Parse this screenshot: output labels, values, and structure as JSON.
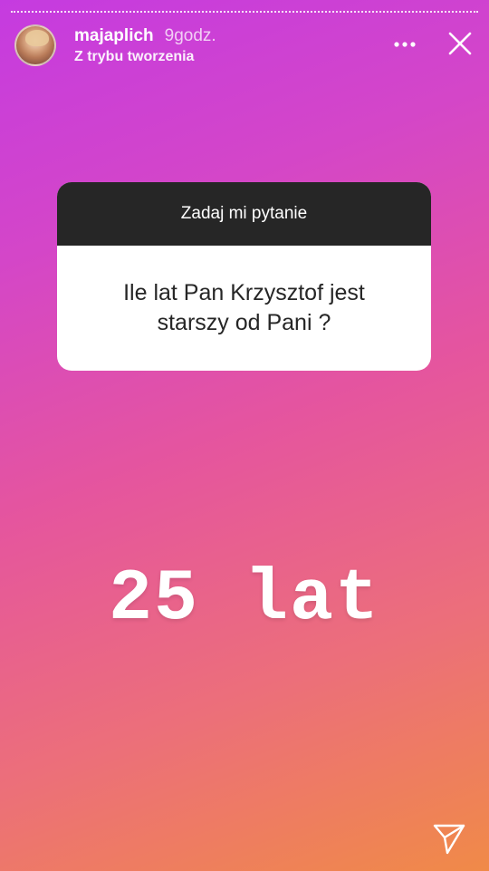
{
  "story": {
    "username": "majaplich",
    "time_ago": "9godz.",
    "subtitle": "Z trybu tworzenia"
  },
  "question_sticker": {
    "header": "Zadaj mi pytanie",
    "question": "Ile lat Pan Krzysztof jest starszy od Pani ?"
  },
  "answer": {
    "text": "25 lat"
  },
  "icons": {
    "more": "more-horizontal-icon",
    "close": "close-icon",
    "send": "send-icon"
  },
  "colors": {
    "gradient_top": "#c53be0",
    "gradient_bottom": "#f08a48",
    "card_header": "#262626",
    "card_body": "#ffffff"
  }
}
